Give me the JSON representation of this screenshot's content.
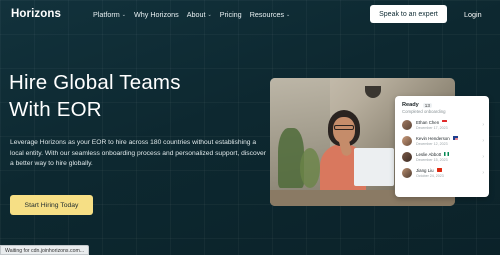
{
  "header": {
    "logo": "Horizons",
    "menu": [
      {
        "label": "Platform",
        "has_dropdown": true
      },
      {
        "label": "Why Horizons",
        "has_dropdown": false
      },
      {
        "label": "About",
        "has_dropdown": true
      },
      {
        "label": "Pricing",
        "has_dropdown": false
      },
      {
        "label": "Resources",
        "has_dropdown": true
      }
    ],
    "cta_label": "Speak to an expert",
    "login_label": "Login"
  },
  "hero": {
    "title_line1": "Hire Global Teams",
    "title_line2": "With EOR",
    "description": "Leverage Horizons as your EOR to hire across 180 countries without establishing a local entity. With our seamless onboarding process and personalized support, discover a better way to hire globally.",
    "cta_label": "Start Hiring Today"
  },
  "card": {
    "title": "Ready",
    "count": "13",
    "subtitle": "Completed onboarding",
    "rows": [
      {
        "name": "Ethan Chen",
        "date": "December 17, 2023",
        "flag": "sg"
      },
      {
        "name": "Kevin Henderson",
        "date": "December 12, 2023",
        "flag": "us"
      },
      {
        "name": "Leslie Abbott",
        "date": "December 15, 2023",
        "flag": "ng"
      },
      {
        "name": "Jiang Liu",
        "date": "October 24, 2023",
        "flag": "cn"
      }
    ]
  },
  "status_bar": "Waiting for cdn.joinhorizons.com...",
  "colors": {
    "background": "#0f2a33",
    "cta": "#f6df85",
    "expert_button": "#ffffff"
  }
}
